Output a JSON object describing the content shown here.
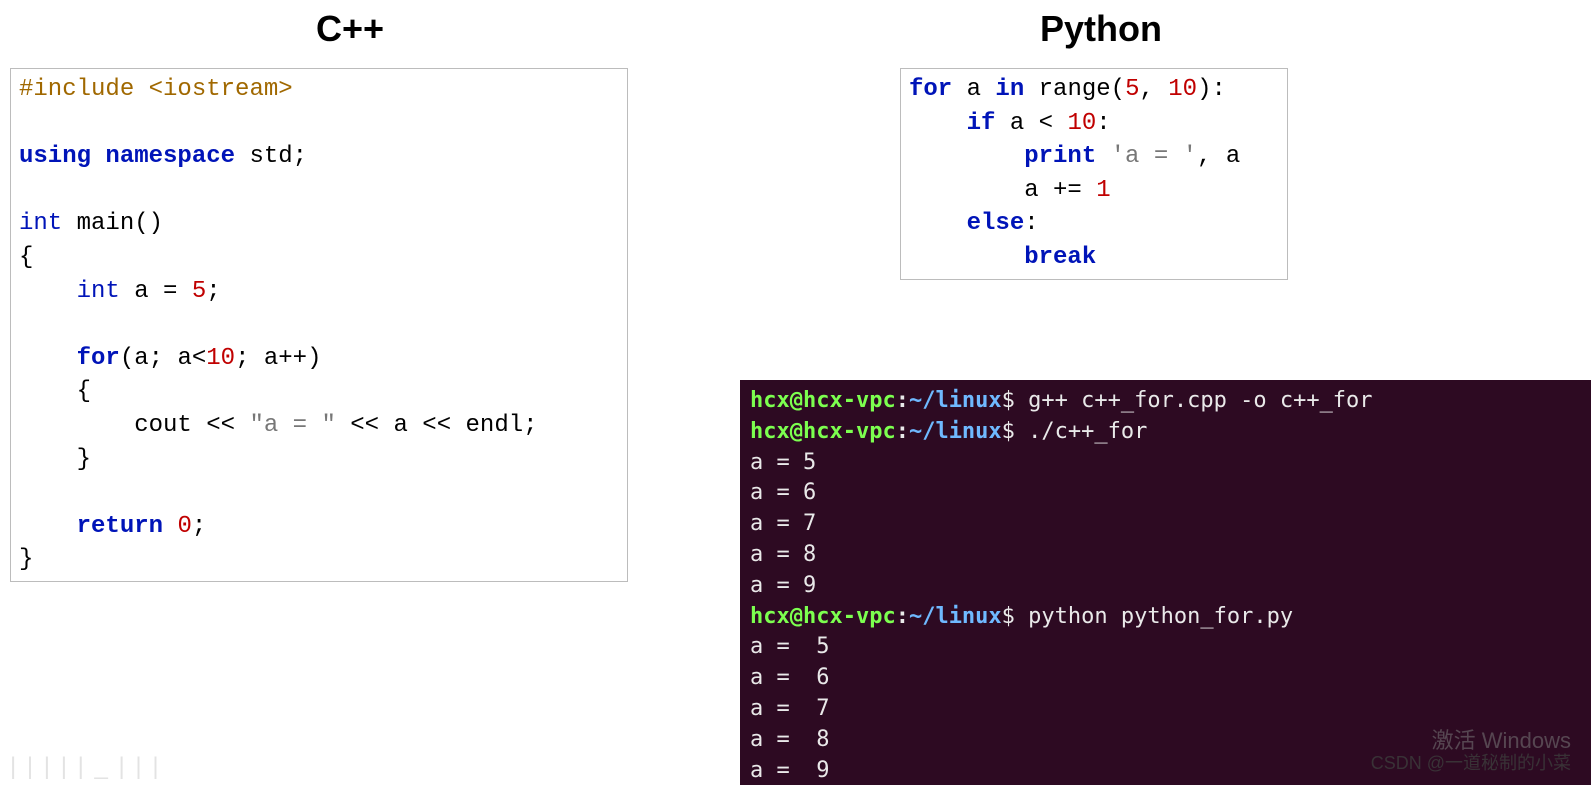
{
  "titles": {
    "left": "C++",
    "right": "Python"
  },
  "cpp": {
    "l1a": "#include ",
    "l1b": "<iostream>",
    "l3a": "using ",
    "l3b": "namespace ",
    "l3c": "std",
    "l3d": ";",
    "l5a": "int ",
    "l5b": "main",
    "l5c": "()",
    "l6": "{",
    "l7a": "    int ",
    "l7b": "a ",
    "l7c": "= ",
    "l7d": "5",
    "l7e": ";",
    "l9a": "    for",
    "l9b": "(a; a<",
    "l9c": "10",
    "l9d": "; a++)",
    "l10": "    {",
    "l11a": "        cout ",
    "l11b": "<< ",
    "l11c": "\"a = \"",
    "l11d": " << ",
    "l11e": "a ",
    "l11f": "<< ",
    "l11g": "endl",
    "l11h": ";",
    "l12": "    }",
    "l14a": "    return ",
    "l14b": "0",
    "l14c": ";",
    "l15": "}"
  },
  "py": {
    "l1a": "for ",
    "l1b": "a ",
    "l1c": "in ",
    "l1d": "range(",
    "l1e": "5",
    "l1f": ", ",
    "l1g": "10",
    "l1h": "):",
    "l2a": "    if ",
    "l2b": "a ",
    "l2c": "< ",
    "l2d": "10",
    "l2e": ":",
    "l3a": "        print ",
    "l3b": "'a = '",
    "l3c": ", a",
    "l4a": "        a ",
    "l4b": "+= ",
    "l4c": "1",
    "l5a": "    else",
    "l5b": ":",
    "l6a": "        break"
  },
  "term": {
    "user": "hcx@hcx-vpc",
    "colon": ":",
    "path": "~/linux",
    "dollar": "$ ",
    "cmd1": "g++ c++_for.cpp -o c++_for",
    "cmd2": "./c++_for",
    "o1": "a = 5",
    "o2": "a = 6",
    "o3": "a = 7",
    "o4": "a = 8",
    "o5": "a = 9",
    "cmd3": "python python_for.py",
    "p1": "a =  5",
    "p2": "a =  6",
    "p3": "a =  7",
    "p4": "a =  8",
    "p5": "a =  9"
  },
  "watermarks": {
    "activate": "激活 Windows",
    "csdn": "CSDN @一道秘制的小菜",
    "bl": "| | | |  | _ | | |"
  }
}
